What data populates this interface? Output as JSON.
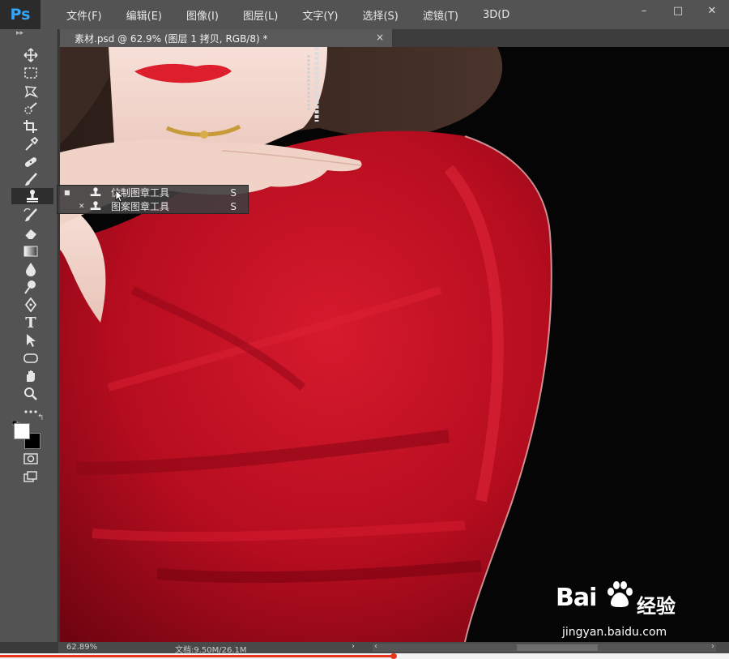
{
  "app": {
    "logo": "Ps"
  },
  "menu": [
    "文件(F)",
    "编辑(E)",
    "图像(I)",
    "图层(L)",
    "文字(Y)",
    "选择(S)",
    "滤镜(T)",
    "3D(D"
  ],
  "window_controls": {
    "minimize": "–",
    "maximize": "□",
    "close": "✕"
  },
  "toolbar": {
    "collapse_label": "▸▸",
    "tools": [
      "move-tool",
      "marquee-tool",
      "lasso-tool",
      "quick-select-tool",
      "crop-tool",
      "eyedropper-tool",
      "healing-brush-tool",
      "brush-tool",
      "clone-stamp-tool",
      "history-brush-tool",
      "eraser-tool",
      "gradient-tool",
      "blur-tool",
      "dodge-tool",
      "pen-tool",
      "type-tool",
      "path-select-tool",
      "shape-tool",
      "hand-tool",
      "zoom-tool",
      "extra-tools",
      "quick-mask",
      "screen-mode"
    ],
    "active_tool": "clone-stamp-tool",
    "type_tool_glyph": "T",
    "foreground_color": "#ffffff",
    "background_color": "#000000",
    "swap_glyph": "↰"
  },
  "document_tab": {
    "title": "素材.psd @ 62.9% (图层 1 拷贝, RGB/8) *",
    "close": "×"
  },
  "flyout": {
    "items": [
      {
        "label": "仿制图章工具",
        "shortcut": "S",
        "marker": "■"
      },
      {
        "label": "图案图章工具",
        "shortcut": "S",
        "marker": "✕"
      }
    ]
  },
  "status": {
    "zoom": "62.89%",
    "doc": "文档:9.50M/26.1M",
    "arrow": "›",
    "scroll_left": "‹",
    "scroll_right": "›"
  },
  "video_progress": 0.54,
  "watermark": {
    "brand": "Bai",
    "suffix": "经验",
    "url": "jingyan.baidu.com"
  },
  "colors": {
    "accent_ps": "#31a8ff",
    "dress_red": "#c40f22",
    "lips": "#dd1f2d",
    "progress": "#e8341c"
  }
}
